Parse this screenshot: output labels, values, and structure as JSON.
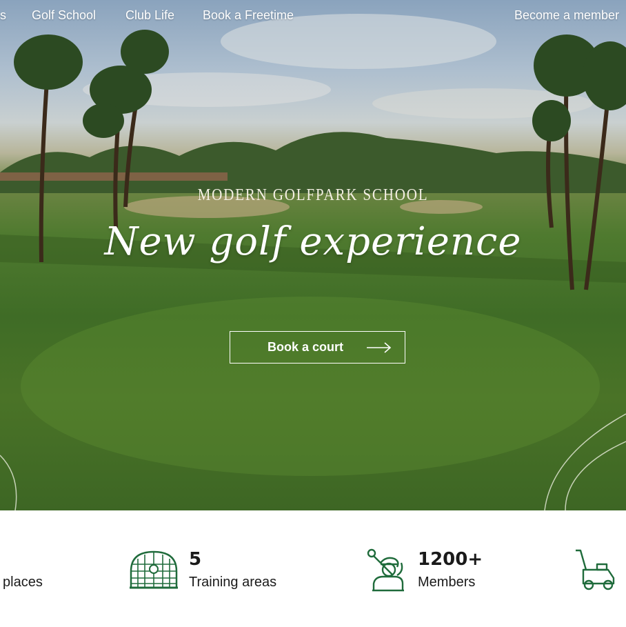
{
  "nav": {
    "items": [
      {
        "label": "s"
      },
      {
        "label": "Golf School"
      },
      {
        "label": "Club Life"
      },
      {
        "label": "Book a Freetime"
      }
    ],
    "cta_label": "Become a member"
  },
  "hero": {
    "subtitle": "MODERN GOLFPARK SCHOOL",
    "headline": "New golf experience",
    "button_label": "Book a court"
  },
  "stats": [
    {
      "value": "",
      "label": "places",
      "icon": "places-icon"
    },
    {
      "value": "5",
      "label": "Training areas",
      "icon": "training-net-icon"
    },
    {
      "value": "1200+",
      "label": "Members",
      "icon": "golfer-icon"
    },
    {
      "value": "",
      "label": "",
      "icon": "golf-cart-icon"
    }
  ],
  "colors": {
    "accent_green": "#1f6b3b",
    "text": "#1a1a1a",
    "hero_text": "#ffffff"
  }
}
